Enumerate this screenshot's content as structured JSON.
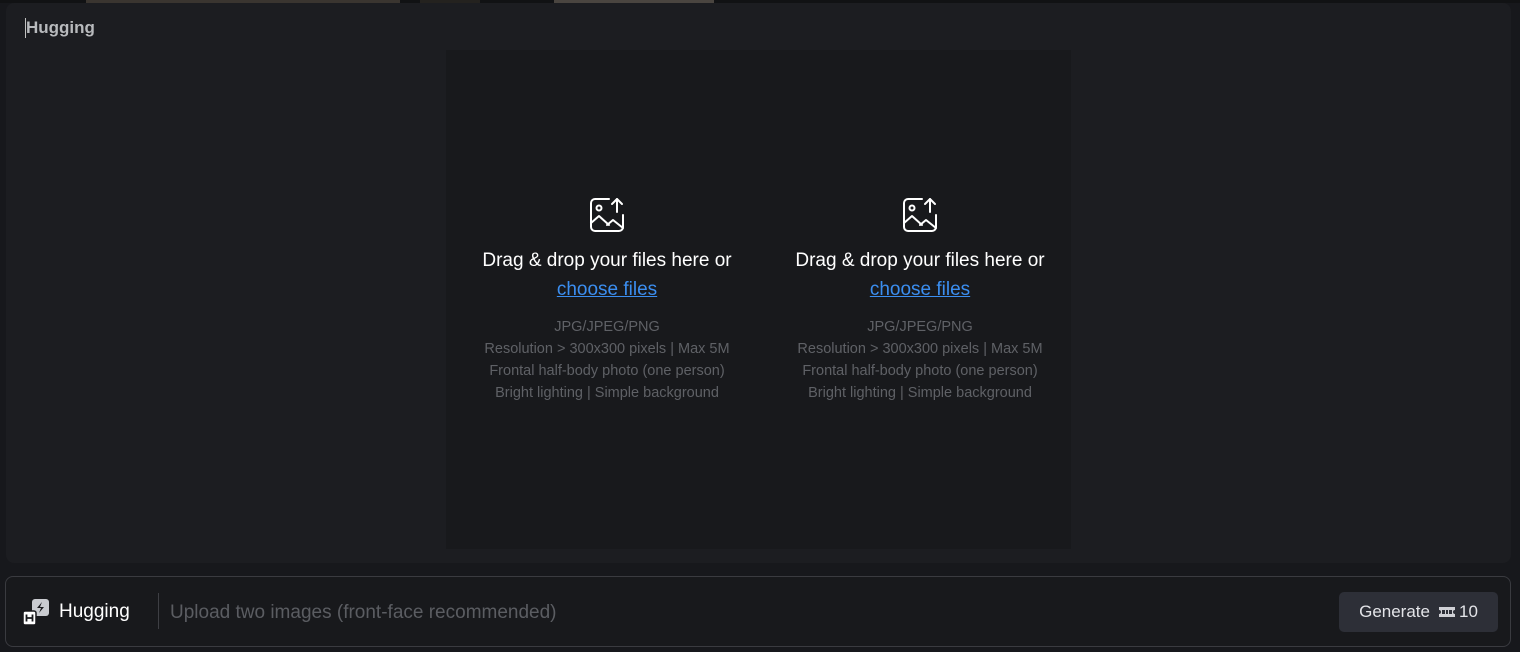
{
  "header": {
    "brand": "Hugging"
  },
  "upload": {
    "zones": [
      {
        "title": "Drag & drop your files here or",
        "link": "choose files",
        "hints": [
          "JPG/JPEG/PNG",
          "Resolution > 300x300 pixels | Max 5M",
          "Frontal half-body photo (one person)",
          "Bright lighting | Simple background"
        ]
      },
      {
        "title": "Drag & drop your files here or",
        "link": "choose files",
        "hints": [
          "JPG/JPEG/PNG",
          "Resolution > 300x300 pixels | Max 5M",
          "Frontal half-body photo (one person)",
          "Bright lighting | Simple background"
        ]
      }
    ]
  },
  "footer": {
    "brand": "Hugging",
    "prompt_placeholder": "Upload two images (front-face recommended)",
    "generate_label": "Generate",
    "credits": "10"
  },
  "icons": {
    "upload": "image-upload-icon",
    "logo": "hugging-logo-icon",
    "credits": "ticket-icon"
  },
  "colors": {
    "link": "#3b8ef0",
    "panel": "#1c1d21",
    "background": "#17181c"
  }
}
